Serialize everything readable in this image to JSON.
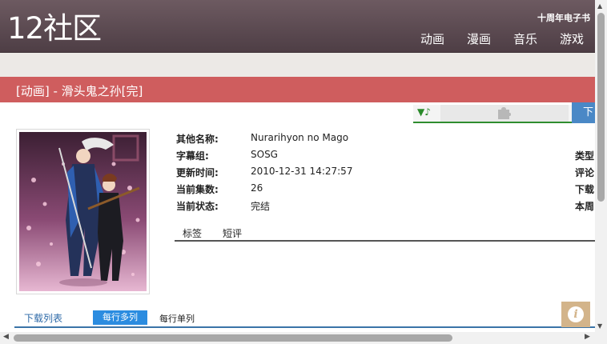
{
  "site": {
    "logo": "12社区",
    "tagline": "十周年电子书",
    "nav": [
      "动画",
      "漫画",
      "音乐",
      "游戏"
    ]
  },
  "page": {
    "title": "[动画] - 滑头鬼之孙[完]",
    "download_label": "下"
  },
  "player": {
    "note_icon": "▼♪",
    "puzzle_icon": "puzzle-icon"
  },
  "info": {
    "rows": [
      {
        "label": "其他名称:",
        "value": "Nurarihyon no Mago"
      },
      {
        "label": "字幕组:",
        "value": "SOSG"
      },
      {
        "label": "更新时间:",
        "value": "2010-12-31 14:27:57"
      },
      {
        "label": "当前集数:",
        "value": "26"
      },
      {
        "label": "当前状态:",
        "value": "完结"
      }
    ],
    "right_labels": [
      "类型",
      "评论",
      "下载",
      "本周"
    ],
    "tabs": [
      "标签",
      "短评"
    ]
  },
  "list": {
    "title": "下载列表",
    "multi": "每行多列",
    "single": "每行单列"
  },
  "info_button": "i",
  "colors": {
    "header": "#5b4950",
    "title_bar": "#cf5d5e",
    "accent_blue": "#2b8ce0",
    "player_green": "#2f8d2f"
  }
}
